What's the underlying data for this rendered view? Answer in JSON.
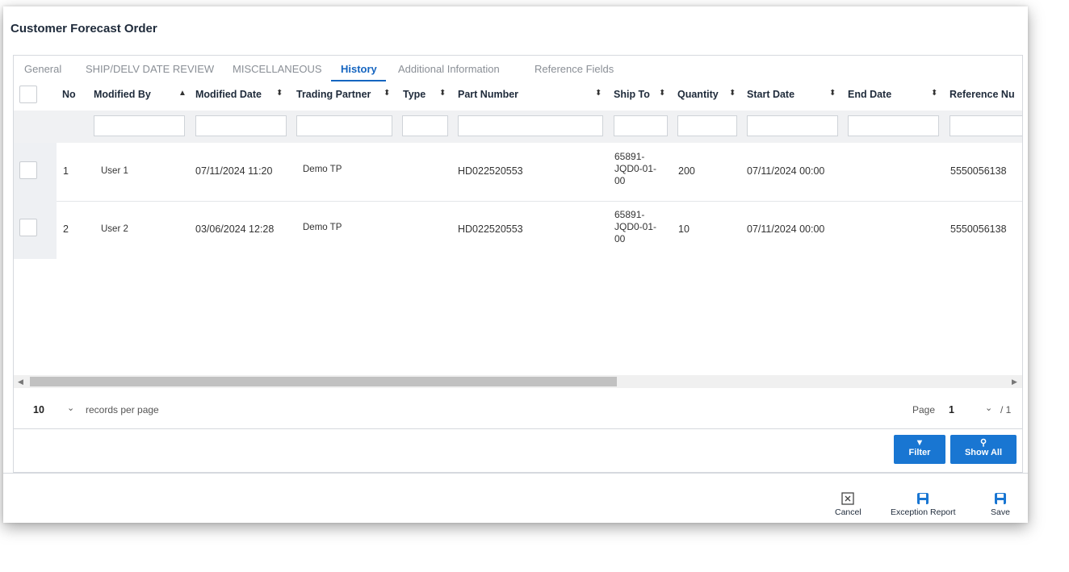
{
  "window": {
    "title": "Customer Forecast Order"
  },
  "tabs": [
    {
      "label": "General"
    },
    {
      "label": "SHIP/DELV DATE REVIEW"
    },
    {
      "label": "MISCELLANEOUS"
    },
    {
      "label": "History"
    },
    {
      "label": "Additional Information"
    },
    {
      "label": "Reference Fields"
    }
  ],
  "active_tab": "History",
  "grid": {
    "columns": [
      {
        "label": "No"
      },
      {
        "label": "Modified By"
      },
      {
        "label": "Modified Date"
      },
      {
        "label": "Trading Partner"
      },
      {
        "label": "Type"
      },
      {
        "label": "Part Number"
      },
      {
        "label": "Ship To"
      },
      {
        "label": "Quantity"
      },
      {
        "label": "Start Date"
      },
      {
        "label": "End Date"
      },
      {
        "label": "Reference Nu"
      }
    ],
    "rows": [
      {
        "no": "1",
        "modified_by": "User 1",
        "modified_date": "07/11/2024 11:20",
        "trading_partner": "Demo TP",
        "type": "",
        "part_number": "HD022520553",
        "ship_to_1": "65891-",
        "ship_to_2": "JQD0-01-",
        "ship_to_3": "00",
        "quantity": "200",
        "start_date": "07/11/2024 00:00",
        "end_date": "",
        "reference": "5550056138"
      },
      {
        "no": "2",
        "modified_by": "User 2",
        "modified_date": "03/06/2024 12:28",
        "trading_partner": "Demo TP",
        "type": "",
        "part_number": "HD022520553",
        "ship_to_1": "65891-",
        "ship_to_2": "JQD0-01-",
        "ship_to_3": "00",
        "quantity": "10",
        "start_date": "07/11/2024 00:00",
        "end_date": "",
        "reference": "5550056138"
      }
    ]
  },
  "pager": {
    "records_per_page": "10",
    "records_label": "records per page",
    "page_label": "Page",
    "page_value": "1",
    "page_total": "/ 1"
  },
  "grid_actions": {
    "filter_label": "Filter",
    "show_all_label": "Show All"
  },
  "footer": {
    "cancel_label": "Cancel",
    "exception_report_label": "Exception Report",
    "save_label": "Save"
  },
  "colors": {
    "accent": "#1976d2",
    "tab_active": "#1565c0"
  }
}
